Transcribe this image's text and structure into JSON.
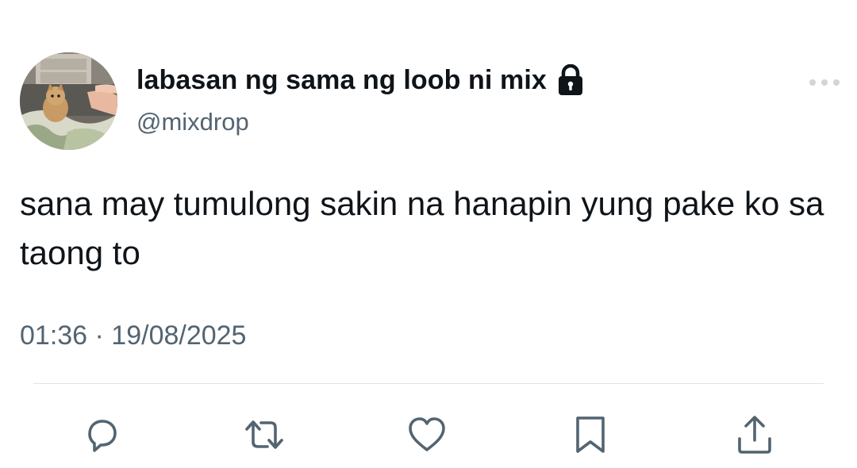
{
  "author": {
    "display_name": "labasan ng sama ng loob ni mix",
    "handle": "@mixdrop",
    "protected": true
  },
  "tweet": {
    "text": "sana may tumulong sakin na hanapin yung pake ko sa taong to",
    "timestamp": "01:36 · 19/08/2025"
  },
  "icons": {
    "avatar": "cat-photo-avatar",
    "lock": "lock-icon",
    "more": "more-options-icon",
    "reply": "reply-icon",
    "retweet": "retweet-icon",
    "like": "like-icon",
    "bookmark": "bookmark-icon",
    "share": "share-icon"
  },
  "colors": {
    "text_primary": "#0f1419",
    "text_secondary": "#536471",
    "divider": "#dfe3e6"
  }
}
